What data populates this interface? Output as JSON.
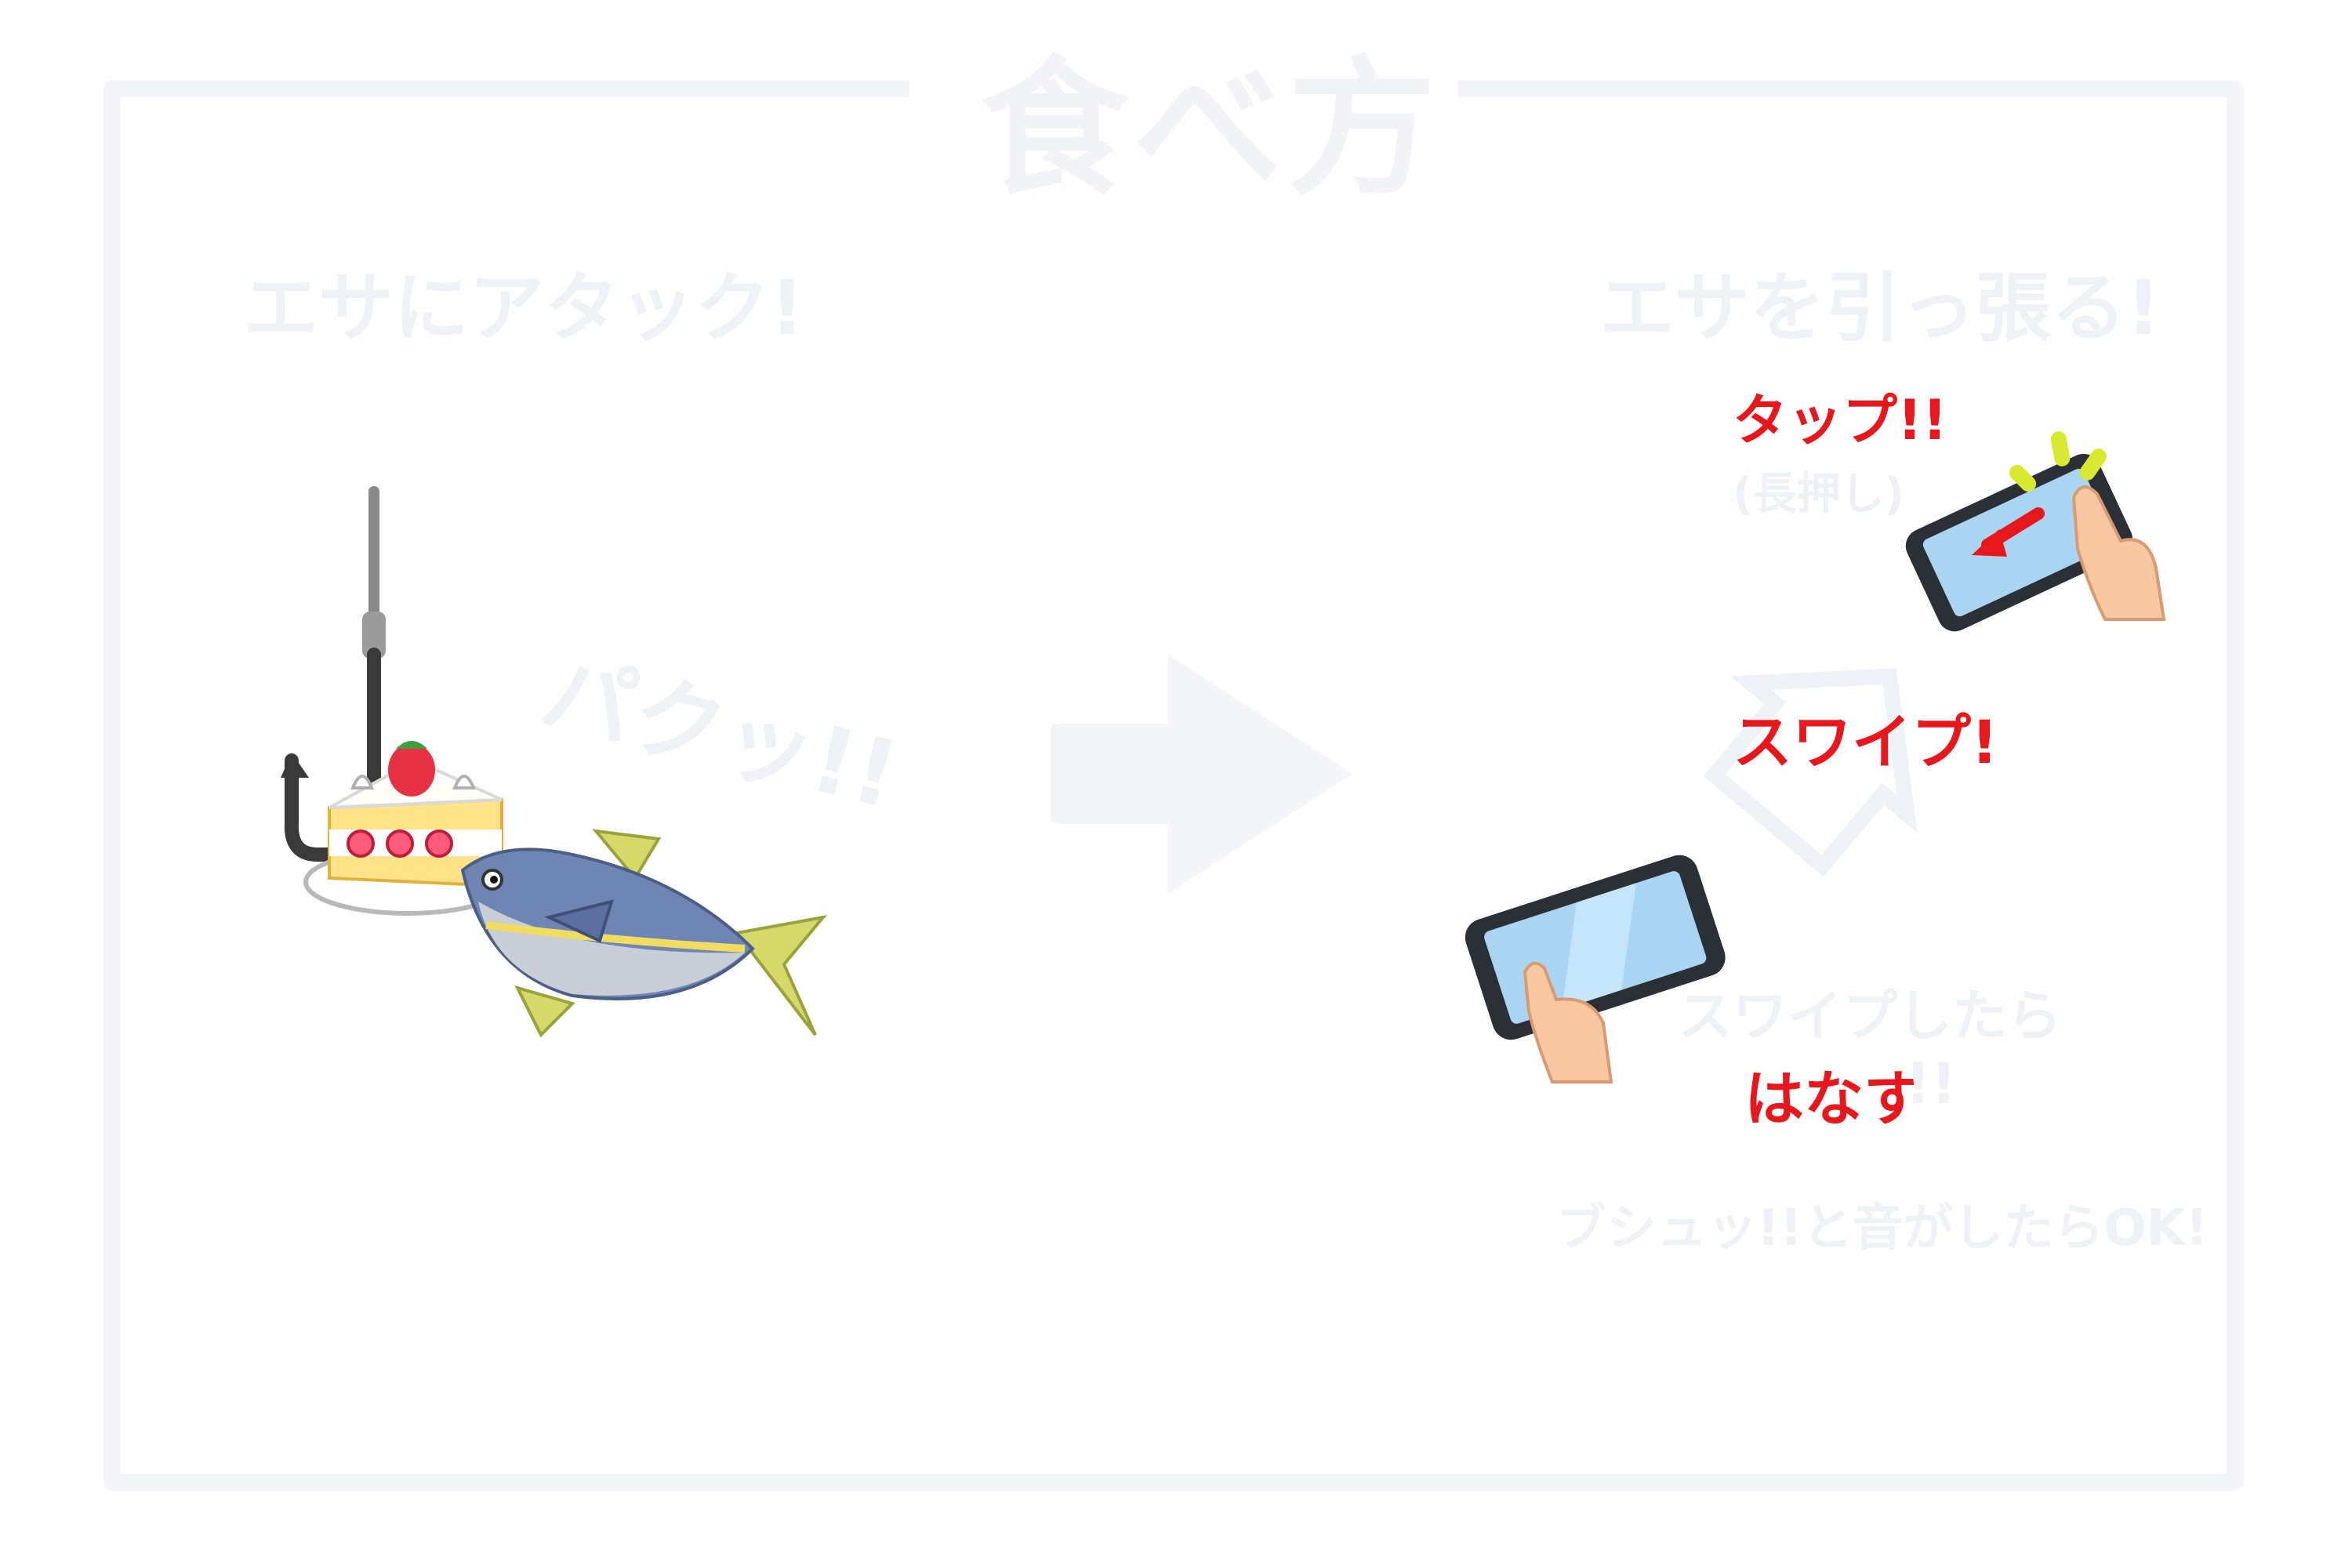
{
  "title": "食べ方",
  "left": {
    "heading": "エサにアタック!",
    "sound": "パクッ!!"
  },
  "right": {
    "heading": "エサを引っ張る!",
    "tap": "タップ!!",
    "long_press": "(長押し)",
    "swipe": "スワイプ!",
    "swipe_after": "スワイプしたら",
    "release": "はなす",
    "release_suffix": "!!",
    "ok_note": "ブシュッ!!と音がしたらOK!"
  },
  "colors": {
    "accent_red": "#e8171b",
    "ghost": "#eef1f6",
    "frame": "#f3f5f9"
  },
  "icons": [
    "fish-hook-icon",
    "cake-icon",
    "fish-icon",
    "arrow-right-icon",
    "phone-tap-icon",
    "phone-swipe-icon",
    "swipe-arrow-icon"
  ]
}
